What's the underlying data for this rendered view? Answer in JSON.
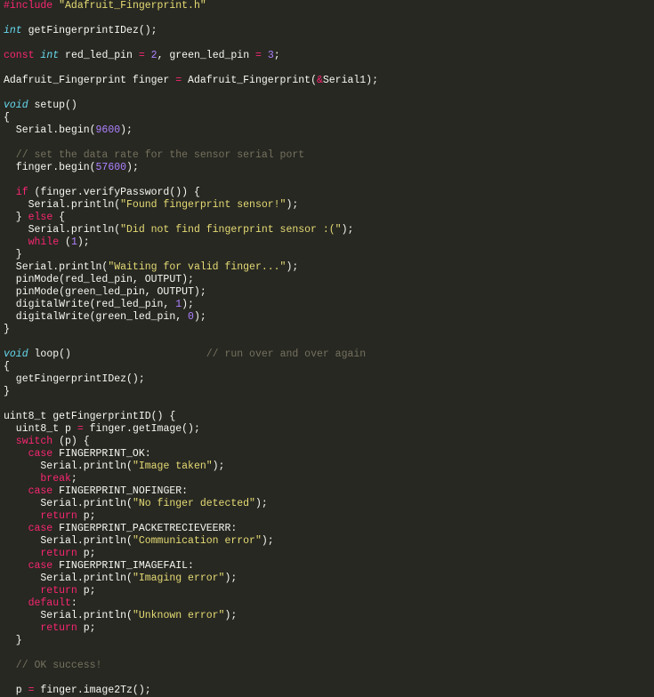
{
  "editor": {
    "language": "Arduino C++",
    "lines": [
      [
        [
          "k",
          "#include "
        ],
        [
          "s",
          "\"Adafruit_Fingerprint.h\""
        ]
      ],
      [],
      [
        [
          "t",
          "int"
        ],
        [
          "p",
          " getFingerprintIDez();"
        ]
      ],
      [],
      [
        [
          "k",
          "const "
        ],
        [
          "t",
          "int"
        ],
        [
          "p",
          " red_led_pin "
        ],
        [
          "k",
          "="
        ],
        [
          "p",
          " "
        ],
        [
          "n",
          "2"
        ],
        [
          "p",
          ", green_led_pin "
        ],
        [
          "k",
          "="
        ],
        [
          "p",
          " "
        ],
        [
          "n",
          "3"
        ],
        [
          "p",
          ";"
        ]
      ],
      [],
      [
        [
          "p",
          "Adafruit_Fingerprint finger "
        ],
        [
          "k",
          "="
        ],
        [
          "p",
          " Adafruit_Fingerprint("
        ],
        [
          "k",
          "&"
        ],
        [
          "p",
          "Serial1);"
        ]
      ],
      [],
      [
        [
          "t",
          "void"
        ],
        [
          "p",
          " setup()"
        ]
      ],
      [
        [
          "p",
          "{"
        ]
      ],
      [
        [
          "p",
          "  Serial.begin("
        ],
        [
          "n",
          "9600"
        ],
        [
          "p",
          ");"
        ]
      ],
      [],
      [
        [
          "c",
          "  // set the data rate for the sensor serial port"
        ]
      ],
      [
        [
          "p",
          "  finger.begin("
        ],
        [
          "n",
          "57600"
        ],
        [
          "p",
          ");"
        ]
      ],
      [],
      [
        [
          "k",
          "  if"
        ],
        [
          "p",
          " (finger.verifyPassword()) {"
        ]
      ],
      [
        [
          "p",
          "    Serial.println("
        ],
        [
          "s",
          "\"Found fingerprint sensor!\""
        ],
        [
          "p",
          ");"
        ]
      ],
      [
        [
          "p",
          "  } "
        ],
        [
          "k",
          "else"
        ],
        [
          "p",
          " {"
        ]
      ],
      [
        [
          "p",
          "    Serial.println("
        ],
        [
          "s",
          "\"Did not find fingerprint sensor :(\""
        ],
        [
          "p",
          ");"
        ]
      ],
      [
        [
          "k",
          "    while"
        ],
        [
          "p",
          " ("
        ],
        [
          "n",
          "1"
        ],
        [
          "p",
          ");"
        ]
      ],
      [
        [
          "p",
          "  }"
        ]
      ],
      [
        [
          "p",
          "  Serial.println("
        ],
        [
          "s",
          "\"Waiting for valid finger...\""
        ],
        [
          "p",
          ");"
        ]
      ],
      [
        [
          "p",
          "  pinMode(red_led_pin, OUTPUT);"
        ]
      ],
      [
        [
          "p",
          "  pinMode(green_led_pin, OUTPUT);"
        ]
      ],
      [
        [
          "p",
          "  digitalWrite(red_led_pin, "
        ],
        [
          "n",
          "1"
        ],
        [
          "p",
          ");"
        ]
      ],
      [
        [
          "p",
          "  digitalWrite(green_led_pin, "
        ],
        [
          "n",
          "0"
        ],
        [
          "p",
          ");"
        ]
      ],
      [
        [
          "p",
          "}"
        ]
      ],
      [],
      [
        [
          "t",
          "void"
        ],
        [
          "p",
          " loop()                      "
        ],
        [
          "c",
          "// run over and over again"
        ]
      ],
      [
        [
          "p",
          "{"
        ]
      ],
      [
        [
          "p",
          "  getFingerprintIDez();"
        ]
      ],
      [
        [
          "p",
          "}"
        ]
      ],
      [],
      [
        [
          "p",
          "uint8_t getFingerprintID() {"
        ]
      ],
      [
        [
          "p",
          "  uint8_t p "
        ],
        [
          "k",
          "="
        ],
        [
          "p",
          " finger.getImage();"
        ]
      ],
      [
        [
          "k",
          "  switch"
        ],
        [
          "p",
          " (p) {"
        ]
      ],
      [
        [
          "k",
          "    case"
        ],
        [
          "p",
          " FINGERPRINT_OK:"
        ]
      ],
      [
        [
          "p",
          "      Serial.println("
        ],
        [
          "s",
          "\"Image taken\""
        ],
        [
          "p",
          ");"
        ]
      ],
      [
        [
          "k",
          "      break"
        ],
        [
          "p",
          ";"
        ]
      ],
      [
        [
          "k",
          "    case"
        ],
        [
          "p",
          " FINGERPRINT_NOFINGER:"
        ]
      ],
      [
        [
          "p",
          "      Serial.println("
        ],
        [
          "s",
          "\"No finger detected\""
        ],
        [
          "p",
          ");"
        ]
      ],
      [
        [
          "k",
          "      return"
        ],
        [
          "p",
          " p;"
        ]
      ],
      [
        [
          "k",
          "    case"
        ],
        [
          "p",
          " FINGERPRINT_PACKETRECIEVEERR:"
        ]
      ],
      [
        [
          "p",
          "      Serial.println("
        ],
        [
          "s",
          "\"Communication error\""
        ],
        [
          "p",
          ");"
        ]
      ],
      [
        [
          "k",
          "      return"
        ],
        [
          "p",
          " p;"
        ]
      ],
      [
        [
          "k",
          "    case"
        ],
        [
          "p",
          " FINGERPRINT_IMAGEFAIL:"
        ]
      ],
      [
        [
          "p",
          "      Serial.println("
        ],
        [
          "s",
          "\"Imaging error\""
        ],
        [
          "p",
          ");"
        ]
      ],
      [
        [
          "k",
          "      return"
        ],
        [
          "p",
          " p;"
        ]
      ],
      [
        [
          "k",
          "    default"
        ],
        [
          "p",
          ":"
        ]
      ],
      [
        [
          "p",
          "      Serial.println("
        ],
        [
          "s",
          "\"Unknown error\""
        ],
        [
          "p",
          ");"
        ]
      ],
      [
        [
          "k",
          "      return"
        ],
        [
          "p",
          " p;"
        ]
      ],
      [
        [
          "p",
          "  }"
        ]
      ],
      [],
      [
        [
          "c",
          "  // OK success!"
        ]
      ],
      [],
      [
        [
          "p",
          "  p "
        ],
        [
          "k",
          "="
        ],
        [
          "p",
          " finger.image2Tz();"
        ]
      ]
    ]
  }
}
